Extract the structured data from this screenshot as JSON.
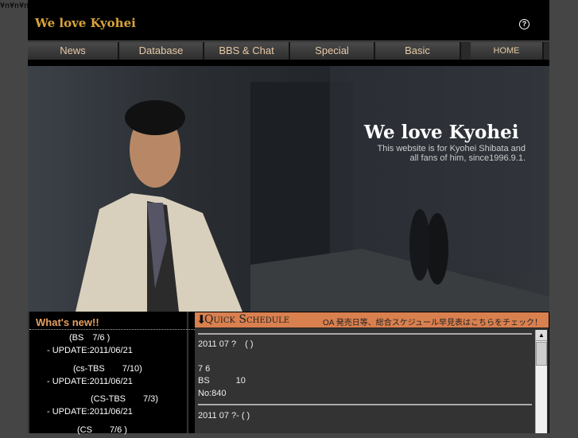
{
  "stray_text": "¥n¥n¥n¥n¥n",
  "header": {
    "logo": "We love Kyohei",
    "help_icon": "?"
  },
  "nav": [
    {
      "label": "News"
    },
    {
      "label": "Database"
    },
    {
      "label": "BBS & Chat"
    },
    {
      "label": "Special"
    },
    {
      "label": "Basic"
    },
    {
      "label": "HOME"
    }
  ],
  "hero": {
    "title": "We love Kyohei",
    "subtitle_1": "This website is for Kyohei Shibata and",
    "subtitle_2": "all fans of him, since1996.9.1."
  },
  "whats_new": {
    "title": "What's new!!",
    "items": [
      {
        "title": "(BS　7/6 )",
        "update": "- UPDATE:2011/06/21"
      },
      {
        "title": "(cs-TBS　　7/10)",
        "update": "- UPDATE:2011/06/21"
      },
      {
        "title": "(CS-TBS　　7/3)",
        "update": "- UPDATE:2011/06/21"
      },
      {
        "title": "(CS　　7/6 )",
        "update": ""
      }
    ]
  },
  "quick_schedule": {
    "title": "Quick Schedule",
    "note": "OA 発売日等、総合スケジュール早見表はこちらをチェック！",
    "entries": [
      {
        "date": "2011 07 ?　( )",
        "lines": [
          "7 6",
          "BS　　　10",
          "No:840"
        ]
      },
      {
        "date": "2011 07 ?- ( )",
        "lines": []
      }
    ]
  }
}
